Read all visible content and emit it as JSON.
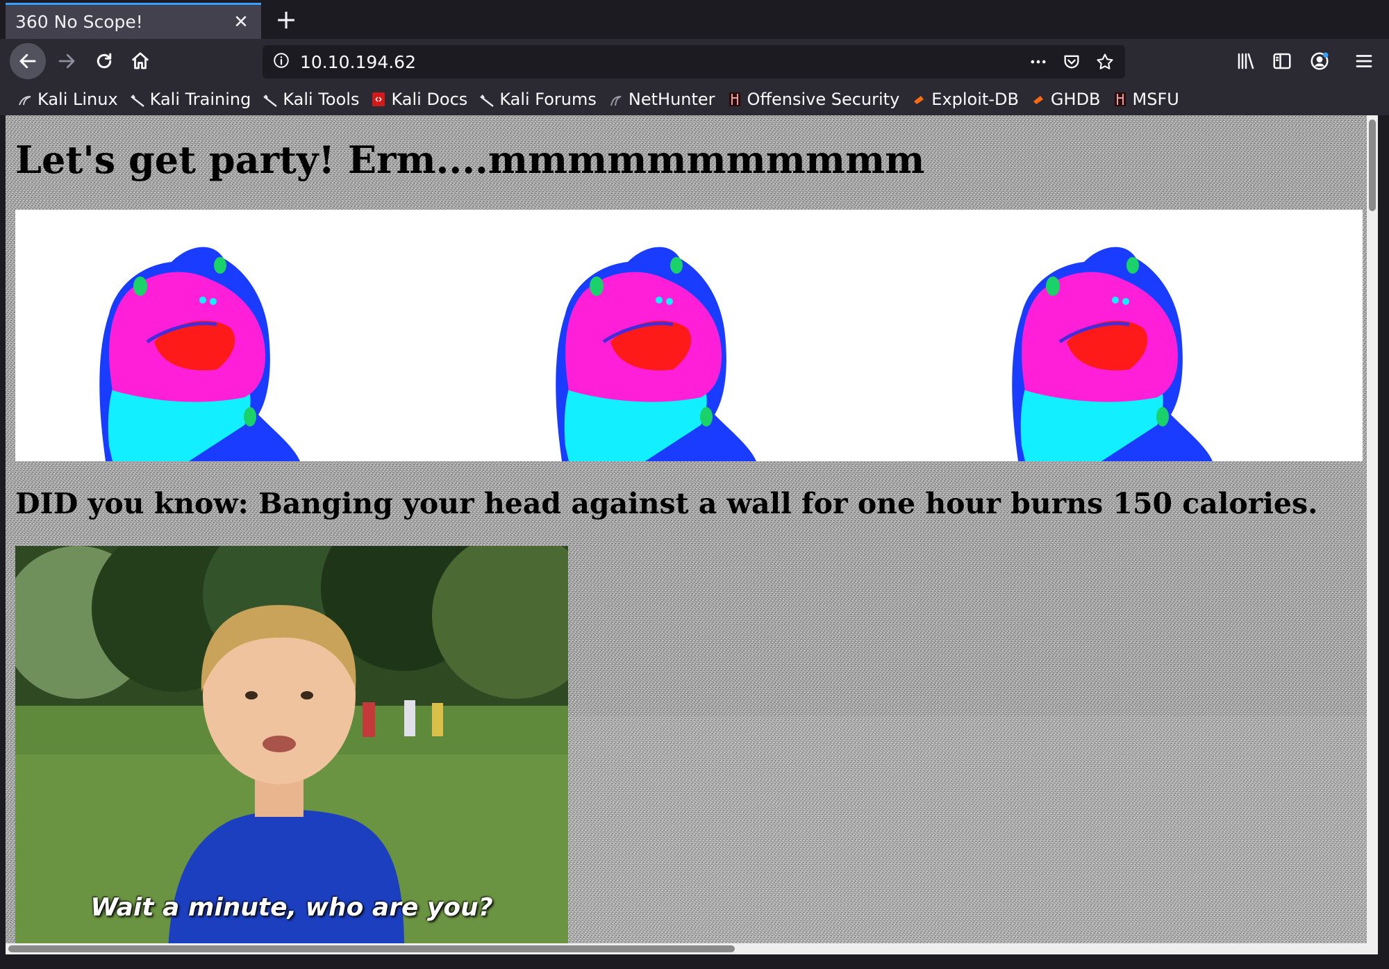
{
  "browser": {
    "tab": {
      "title": "360 No Scope!"
    },
    "address": {
      "url": "10.10.194.62"
    },
    "bookmarks": [
      {
        "label": "Kali Linux",
        "icon": "kali-dragon-icon"
      },
      {
        "label": "Kali Training",
        "icon": "kali-dragon-icon"
      },
      {
        "label": "Kali Tools",
        "icon": "kali-dragon-icon"
      },
      {
        "label": "Kali Docs",
        "icon": "kali-docs-icon"
      },
      {
        "label": "Kali Forums",
        "icon": "kali-dragon-icon"
      },
      {
        "label": "NetHunter",
        "icon": "nethunter-icon"
      },
      {
        "label": "Offensive Security",
        "icon": "offsec-icon"
      },
      {
        "label": "Exploit-DB",
        "icon": "exploitdb-icon"
      },
      {
        "label": "GHDB",
        "icon": "exploitdb-icon"
      },
      {
        "label": "MSFU",
        "icon": "offsec-icon"
      }
    ]
  },
  "page": {
    "heading": "Let's get party! Erm....mmmmmmmmmmm",
    "fact": "DID you know: Banging your head against a wall for one hour burns 150 calories.",
    "gif_caption": "Wait a minute, who are you?"
  },
  "colors": {
    "accent": "#3aa0ff",
    "frog_magenta": "#ff1fd8",
    "frog_blue": "#1a3cff",
    "frog_cyan": "#12f0ff"
  }
}
